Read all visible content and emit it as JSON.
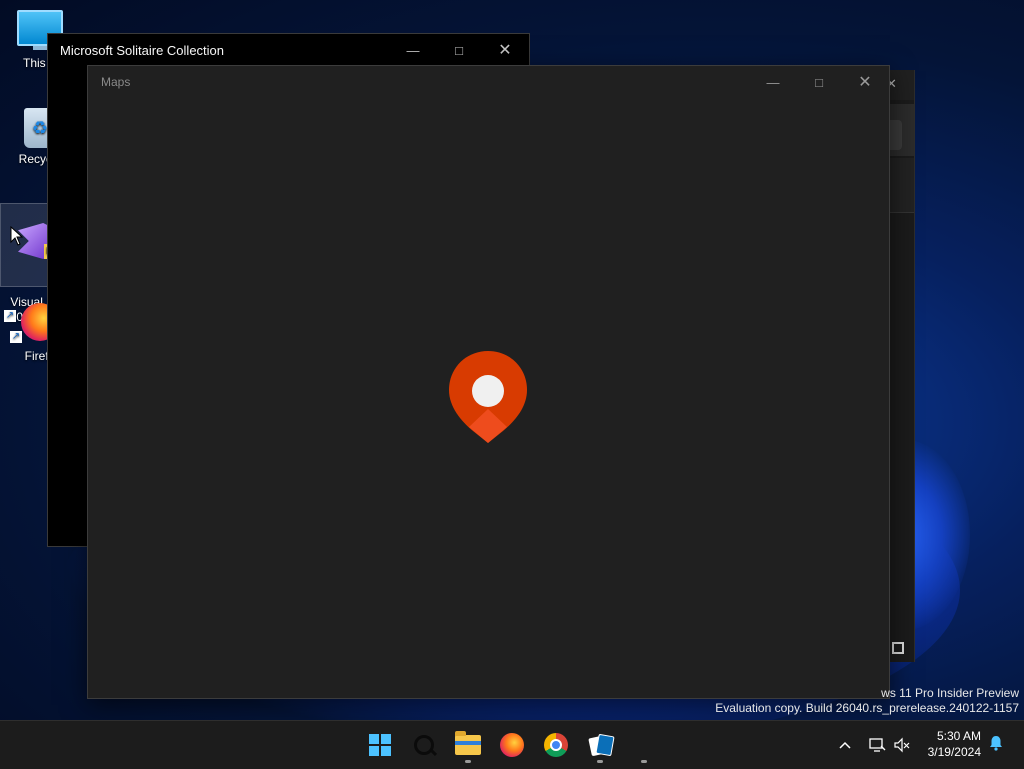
{
  "desktop": {
    "icons": [
      {
        "label": "This P"
      },
      {
        "label": "Recycle"
      },
      {
        "label": "Visual St\n2022 Pre"
      },
      {
        "label": "Firefo"
      }
    ],
    "icon_badge": "PR"
  },
  "solitaire_window": {
    "title": "Microsoft Solitaire Collection"
  },
  "maps_window": {
    "title": "Maps"
  },
  "watermark": {
    "line1": "ws 11 Pro Insider Preview",
    "line2": "Evaluation copy. Build 26040.rs_prerelease.240122-1157"
  },
  "taskbar": {
    "items": [
      "start",
      "search",
      "file-explorer",
      "firefox",
      "chrome",
      "solitaire"
    ]
  },
  "tray": {
    "time": "5:30 AM",
    "date": "3/19/2024"
  },
  "colors": {
    "accent": "#4cc2ff",
    "maps_pin": "#d83b01",
    "window_bg": "#202020"
  }
}
